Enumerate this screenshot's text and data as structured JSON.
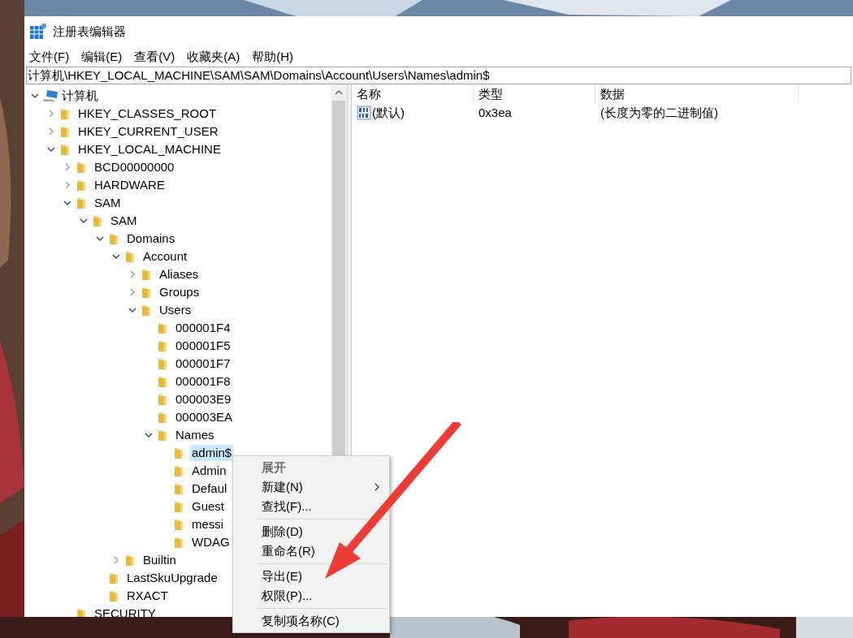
{
  "window": {
    "title": "注册表编辑器"
  },
  "menu_bar": [
    "文件(F)",
    "编辑(E)",
    "查看(V)",
    "收藏夹(A)",
    "帮助(H)"
  ],
  "address": "计算机\\HKEY_LOCAL_MACHINE\\SAM\\SAM\\Domains\\Account\\Users\\Names\\admin$",
  "tree": [
    {
      "label": "计算机",
      "kind": "computer",
      "expanded": true,
      "selected": false,
      "children": [
        {
          "label": "HKEY_CLASSES_ROOT",
          "kind": "folder",
          "expanded": false,
          "selected": false
        },
        {
          "label": "HKEY_CURRENT_USER",
          "kind": "folder",
          "expanded": false,
          "selected": false
        },
        {
          "label": "HKEY_LOCAL_MACHINE",
          "kind": "folder",
          "expanded": true,
          "selected": false,
          "children": [
            {
              "label": "BCD00000000",
              "kind": "folder",
              "expanded": false,
              "selected": false
            },
            {
              "label": "HARDWARE",
              "kind": "folder",
              "expanded": false,
              "selected": false
            },
            {
              "label": "SAM",
              "kind": "folder",
              "expanded": true,
              "selected": false,
              "children": [
                {
                  "label": "SAM",
                  "kind": "folder",
                  "expanded": true,
                  "selected": false,
                  "children": [
                    {
                      "label": "Domains",
                      "kind": "folder",
                      "expanded": true,
                      "selected": false,
                      "children": [
                        {
                          "label": "Account",
                          "kind": "folder",
                          "expanded": true,
                          "selected": false,
                          "children": [
                            {
                              "label": "Aliases",
                              "kind": "folder",
                              "expanded": false,
                              "selected": false
                            },
                            {
                              "label": "Groups",
                              "kind": "folder",
                              "expanded": false,
                              "selected": false
                            },
                            {
                              "label": "Users",
                              "kind": "folder",
                              "expanded": true,
                              "selected": false,
                              "children": [
                                {
                                  "label": "000001F4",
                                  "kind": "folder",
                                  "selected": false
                                },
                                {
                                  "label": "000001F5",
                                  "kind": "folder",
                                  "selected": false
                                },
                                {
                                  "label": "000001F7",
                                  "kind": "folder",
                                  "selected": false
                                },
                                {
                                  "label": "000001F8",
                                  "kind": "folder",
                                  "selected": false
                                },
                                {
                                  "label": "000003E9",
                                  "kind": "folder",
                                  "selected": false
                                },
                                {
                                  "label": "000003EA",
                                  "kind": "folder",
                                  "selected": false
                                },
                                {
                                  "label": "Names",
                                  "kind": "folder",
                                  "expanded": true,
                                  "selected": false,
                                  "children": [
                                    {
                                      "label": "admin$",
                                      "kind": "folder",
                                      "selected": true
                                    },
                                    {
                                      "label": "Admin",
                                      "kind": "folder",
                                      "selected": false
                                    },
                                    {
                                      "label": "Defaul",
                                      "kind": "folder",
                                      "selected": false
                                    },
                                    {
                                      "label": "Guest",
                                      "kind": "folder",
                                      "selected": false
                                    },
                                    {
                                      "label": "messi",
                                      "kind": "folder",
                                      "selected": false
                                    },
                                    {
                                      "label": "WDAG",
                                      "kind": "folder",
                                      "selected": false
                                    }
                                  ]
                                }
                              ]
                            }
                          ]
                        },
                        {
                          "label": "Builtin",
                          "kind": "folder",
                          "expanded": false,
                          "selected": false
                        }
                      ]
                    },
                    {
                      "label": "LastSkuUpgrade",
                      "kind": "folder",
                      "selected": false
                    },
                    {
                      "label": "RXACT",
                      "kind": "folder",
                      "selected": false
                    }
                  ]
                }
              ]
            },
            {
              "label": "SECURITY",
              "kind": "folder",
              "selected": false
            }
          ]
        }
      ]
    }
  ],
  "values_table": {
    "columns": [
      "名称",
      "类型",
      "数据"
    ],
    "rows": [
      {
        "name": "(默认)",
        "type": "0x3ea",
        "data": "(长度为零的二进制值)"
      }
    ]
  },
  "context_menu": [
    {
      "kind": "item",
      "label": "展开",
      "disabled": true,
      "default": true
    },
    {
      "kind": "item",
      "label": "新建(N)",
      "disabled": false,
      "submenu": true
    },
    {
      "kind": "item",
      "label": "查找(F)...",
      "disabled": false
    },
    {
      "kind": "separator"
    },
    {
      "kind": "item",
      "label": "删除(D)",
      "disabled": false
    },
    {
      "kind": "item",
      "label": "重命名(R)",
      "disabled": false
    },
    {
      "kind": "separator"
    },
    {
      "kind": "item",
      "label": "导出(E)",
      "disabled": false
    },
    {
      "kind": "item",
      "label": "权限(P)...",
      "disabled": false
    },
    {
      "kind": "separator"
    },
    {
      "kind": "item",
      "label": "复制项名称(C)",
      "disabled": false
    }
  ]
}
